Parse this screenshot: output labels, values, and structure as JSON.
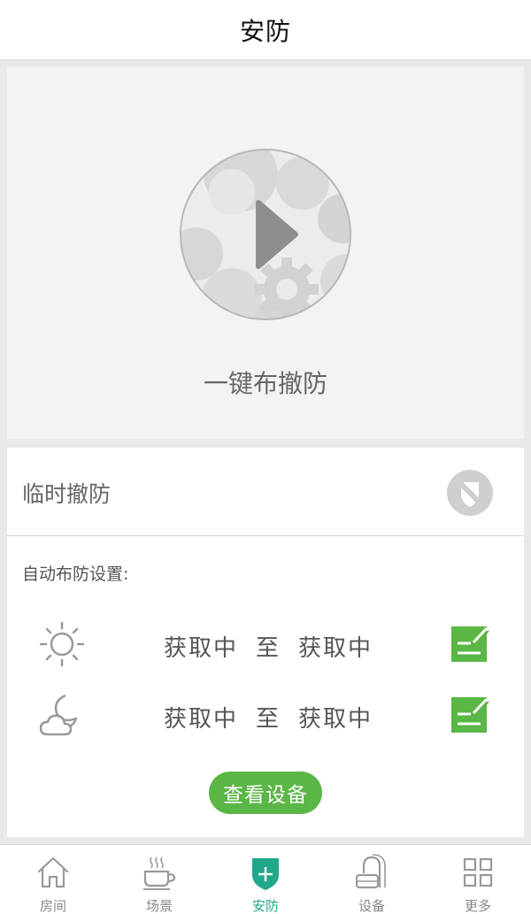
{
  "header": {
    "title": "安防"
  },
  "arm": {
    "label": "一键布撤防"
  },
  "temporary": {
    "label": "临时撤防"
  },
  "auto": {
    "title": "自动布防设置:",
    "day": {
      "start": "获取中",
      "sep": "至",
      "end": "获取中"
    },
    "night": {
      "start": "获取中",
      "sep": "至",
      "end": "获取中"
    }
  },
  "view_devices": {
    "label": "查看设备"
  },
  "tabs": [
    {
      "label": "房间",
      "icon": "house-icon"
    },
    {
      "label": "场景",
      "icon": "coffee-cup-icon"
    },
    {
      "label": "安防",
      "icon": "shield-plus-icon"
    },
    {
      "label": "设备",
      "icon": "device-icon"
    },
    {
      "label": "更多",
      "icon": "grid-icon"
    }
  ],
  "colors": {
    "accent_green": "#5ab645",
    "active_tab": "#21a78a"
  }
}
